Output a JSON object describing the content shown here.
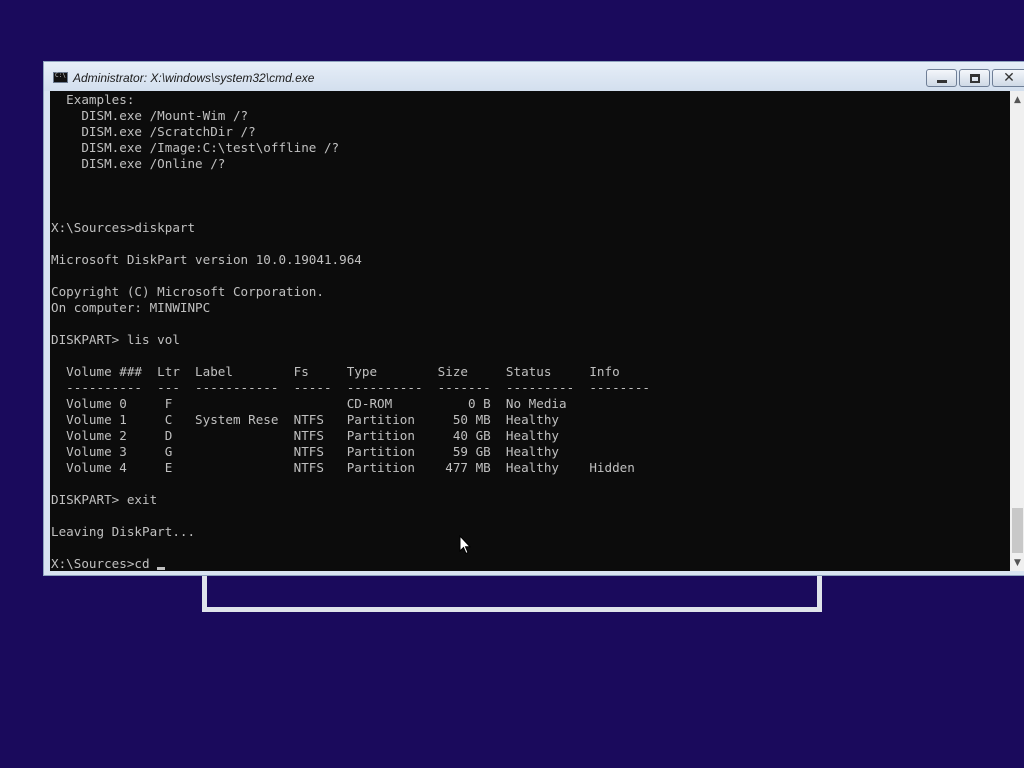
{
  "window": {
    "title": "Administrator: X:\\windows\\system32\\cmd.exe",
    "icon": "cmd-icon",
    "buttons": {
      "minimize": "minimize",
      "maximize": "maximize",
      "close": "close"
    }
  },
  "console": {
    "lines": [
      "  Examples:",
      "    DISM.exe /Mount-Wim /?",
      "    DISM.exe /ScratchDir /?",
      "    DISM.exe /Image:C:\\test\\offline /?",
      "    DISM.exe /Online /?",
      "",
      "",
      "",
      "X:\\Sources>diskpart",
      "",
      "Microsoft DiskPart version 10.0.19041.964",
      "",
      "Copyright (C) Microsoft Corporation.",
      "On computer: MINWINPC",
      "",
      "DISKPART> lis vol",
      "",
      "  Volume ###  Ltr  Label        Fs     Type        Size     Status     Info",
      "  ----------  ---  -----------  -----  ----------  -------  ---------  --------",
      "  Volume 0     F                       CD-ROM          0 B  No Media",
      "  Volume 1     C   System Rese  NTFS   Partition     50 MB  Healthy",
      "  Volume 2     D                NTFS   Partition     40 GB  Healthy",
      "  Volume 3     G                NTFS   Partition     59 GB  Healthy",
      "  Volume 4     E                NTFS   Partition    477 MB  Healthy    Hidden",
      "",
      "DISKPART> exit",
      "",
      "Leaving DiskPart...",
      ""
    ],
    "prompt": "X:\\Sources>cd "
  },
  "colors": {
    "desktop": "#1a0a5c",
    "console_bg": "#0c0c0c",
    "console_fg": "#c0c0c0"
  }
}
